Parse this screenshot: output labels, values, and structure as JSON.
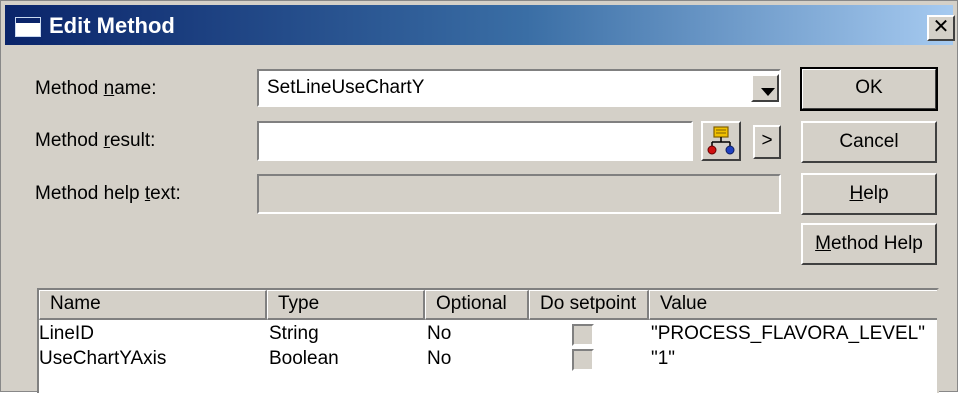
{
  "window": {
    "title": "Edit Method",
    "close_glyph": "✕"
  },
  "form": {
    "method_name_label_pre": "Method ",
    "method_name_label_key": "n",
    "method_name_label_post": "ame:",
    "method_name_value": "SetLineUseChartY",
    "method_result_label_pre": "Method ",
    "method_result_label_key": "r",
    "method_result_label_post": "esult:",
    "method_result_value": "",
    "method_result_arrow": ">",
    "method_help_label_pre": "Method help ",
    "method_help_label_key": "t",
    "method_help_label_post": "ext:",
    "method_help_value": ""
  },
  "buttons": {
    "ok": "OK",
    "cancel": "Cancel",
    "help_key": "H",
    "help_rest": "elp",
    "method_help_key": "M",
    "method_help_rest": "ethod Help"
  },
  "table": {
    "columns": [
      "Name",
      "Type",
      "Optional",
      "Do setpoint",
      "Value"
    ],
    "rows": [
      {
        "name": "LineID",
        "type": "String",
        "optional": "No",
        "do_setpoint": false,
        "value": "\"PROCESS_FLAVORA_LEVEL\""
      },
      {
        "name": "UseChartYAxis",
        "type": "Boolean",
        "optional": "No",
        "do_setpoint": false,
        "value": "\"1\""
      }
    ]
  },
  "icons": [
    "window-icon",
    "close-icon",
    "dropdown-arrow-icon",
    "browse-tags-icon"
  ]
}
